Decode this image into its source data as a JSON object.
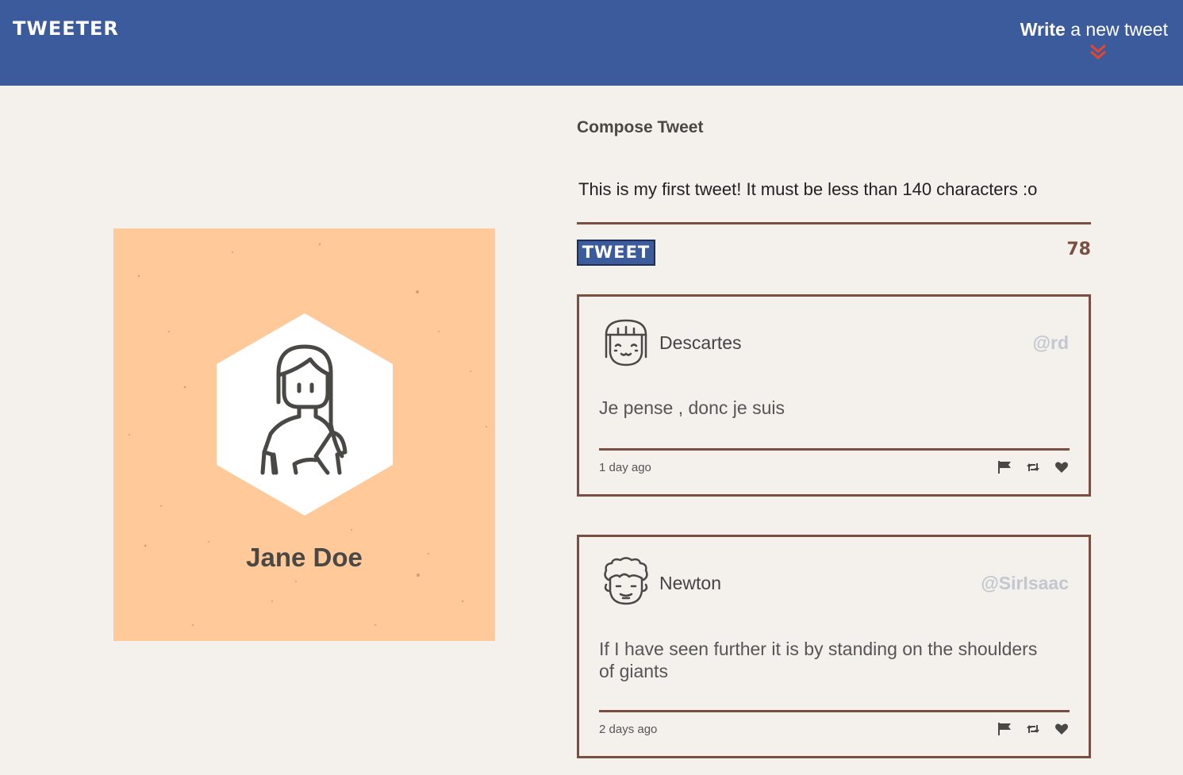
{
  "navbar": {
    "brand": "TWEETER",
    "write_bold": "Write",
    "write_rest": " a new tweet"
  },
  "profile": {
    "name": "Jane Doe",
    "card_color": "#ffc999"
  },
  "compose": {
    "title": "Compose Tweet",
    "text": "This is my first tweet! It must be less than 140 characters :o",
    "button_label": "TWEET",
    "counter": "78"
  },
  "tweets": [
    {
      "name": "Descartes",
      "handle": "@rd",
      "content": "Je pense , donc je suis",
      "time": "1 day ago"
    },
    {
      "name": "Newton",
      "handle": "@SirIsaac",
      "content": "If I have seen further it is by standing on the shoulders of giants",
      "time": "2 days ago"
    }
  ],
  "colors": {
    "nav": "#3b5b9d",
    "accent": "#7a4f42",
    "chevron": "#e8452c",
    "background": "#f4f1ec"
  }
}
